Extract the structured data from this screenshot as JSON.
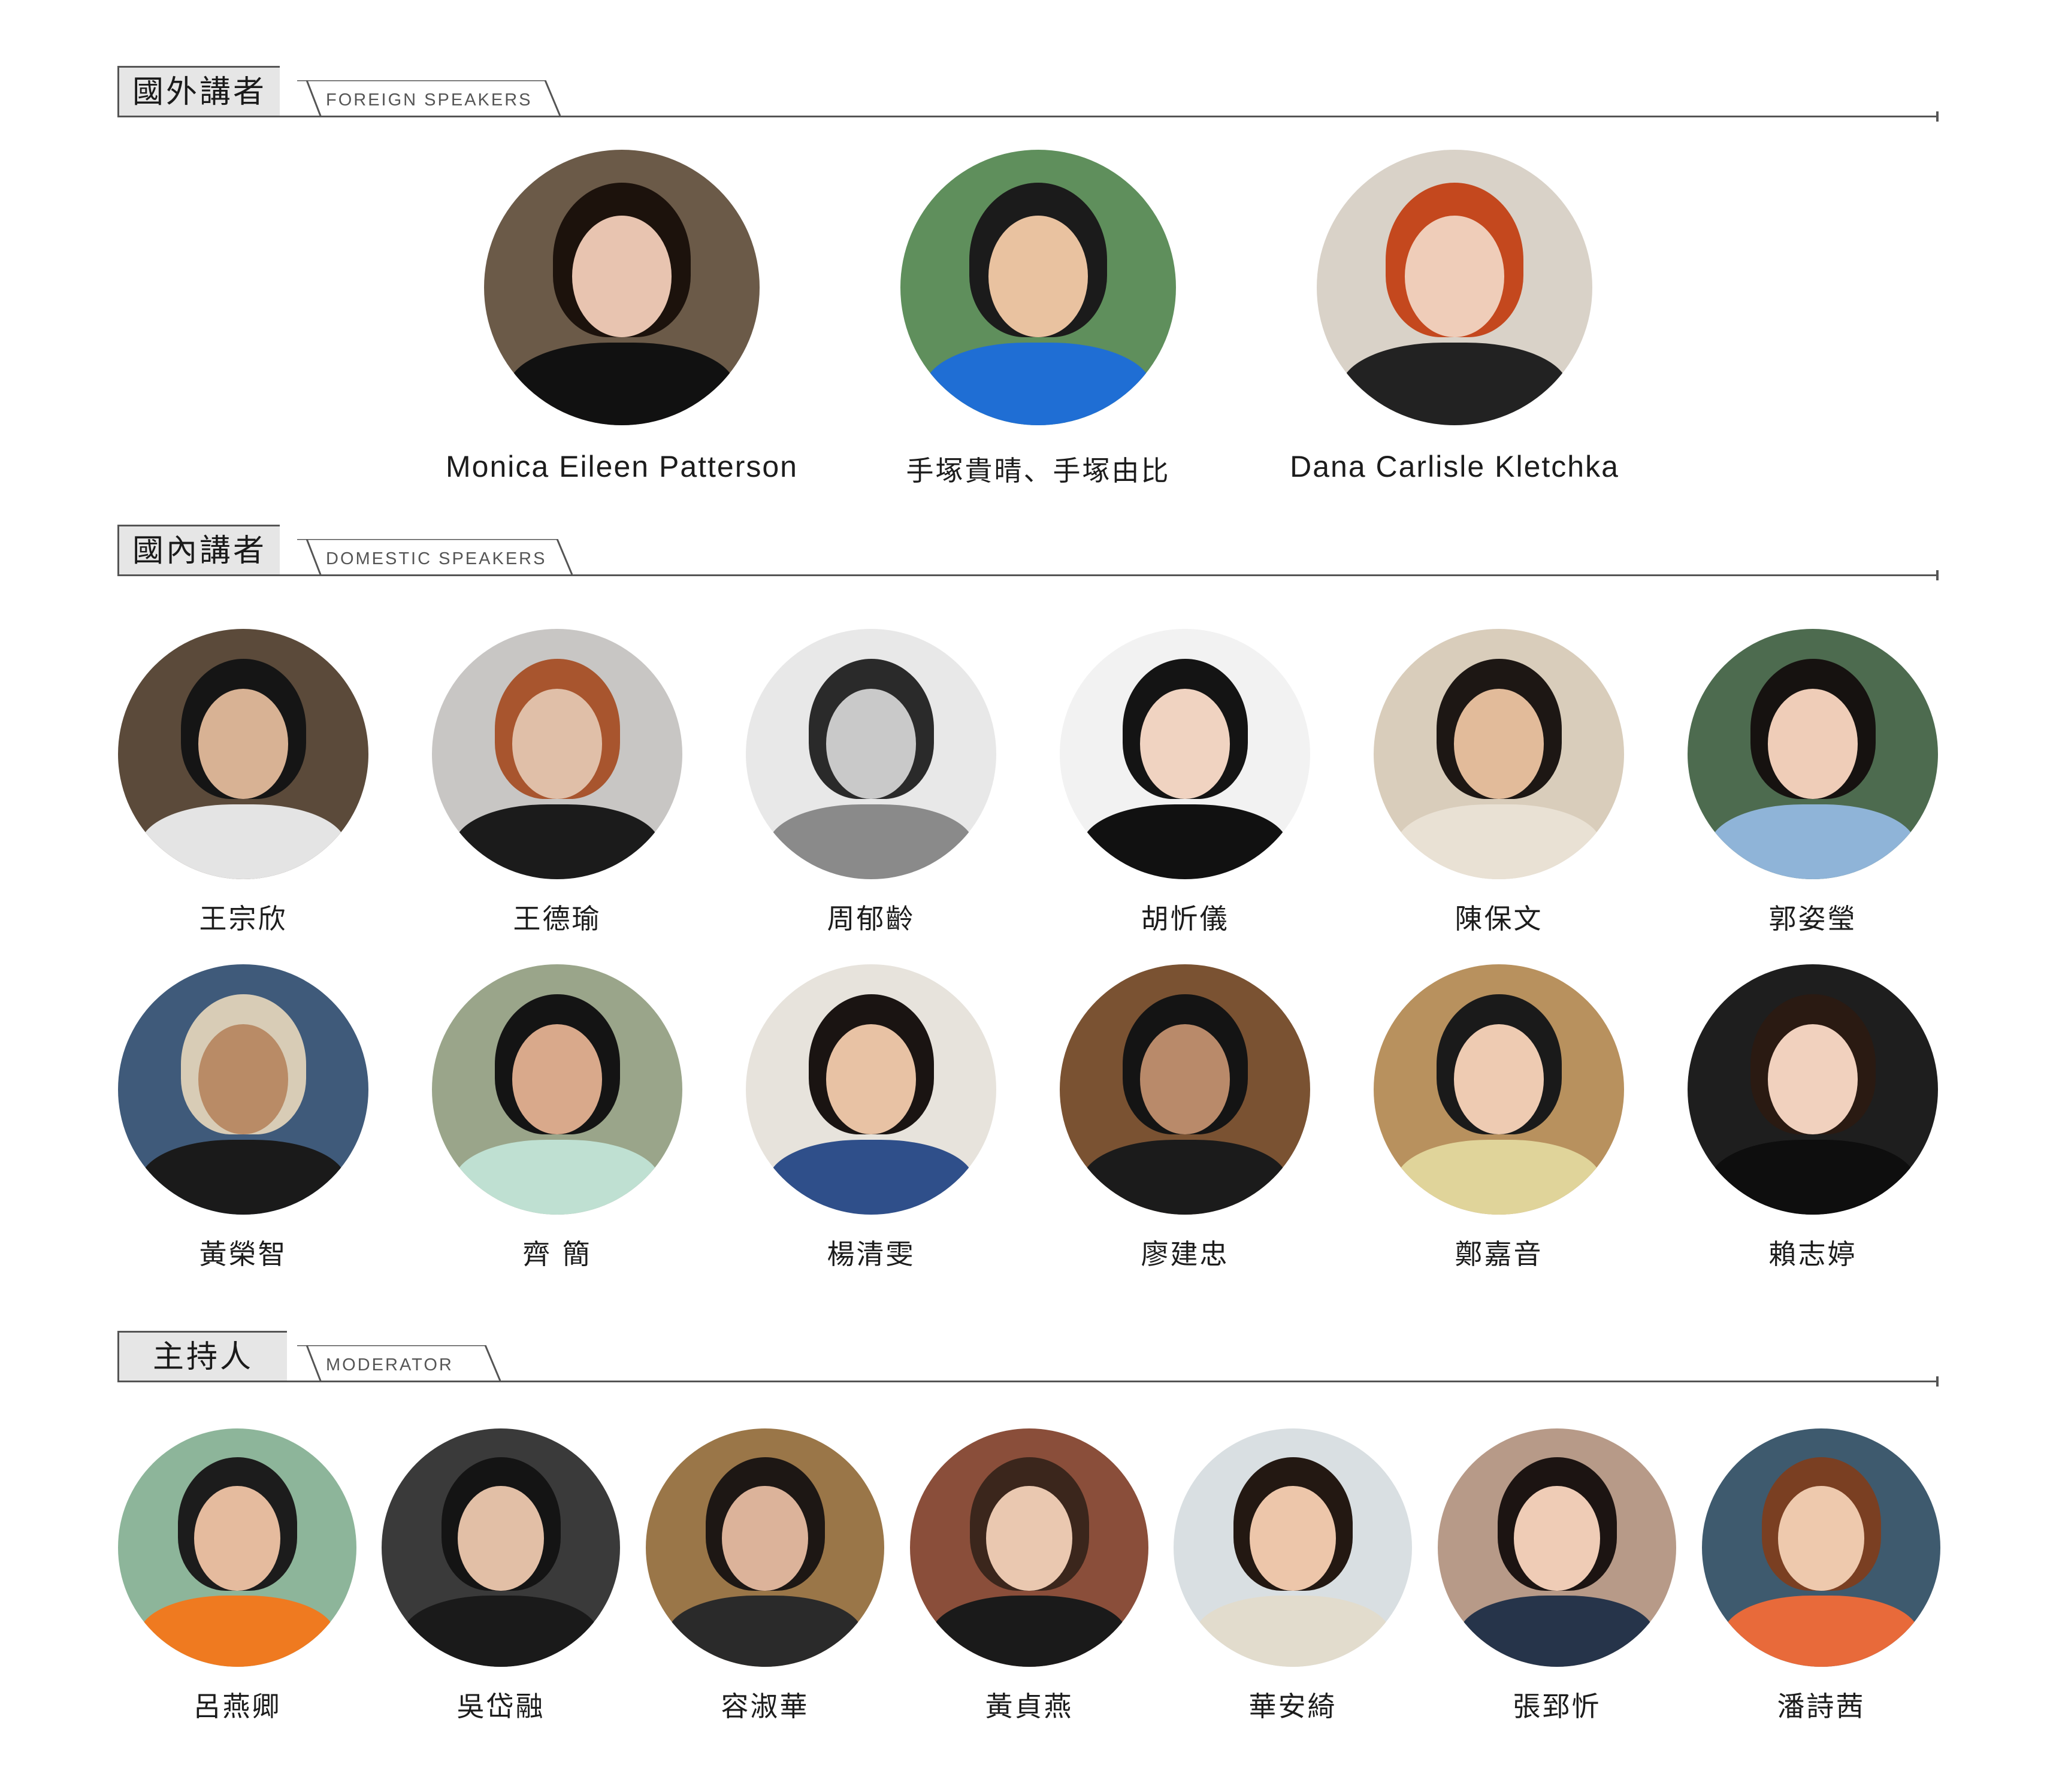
{
  "sections": {
    "foreign": {
      "title_cn": "國外講者",
      "title_en": "FOREIGN SPEAKERS",
      "speakers": [
        {
          "name": "Monica Eileen Patterson",
          "bg": "#6b5a48",
          "skin": "#e8c4b0",
          "hair": "#1c120c",
          "shirt": "#111111"
        },
        {
          "name": "手塚貴晴、手塚由比",
          "bg": "#5f8f5c",
          "skin": "#e9c2a0",
          "hair": "#1b1b1b",
          "shirt": "#1f6ed4"
        },
        {
          "name": "Dana Carlisle Kletchka",
          "bg": "#d9d2c8",
          "skin": "#efcdb9",
          "hair": "#c4481e",
          "shirt": "#222222"
        }
      ]
    },
    "domestic": {
      "title_cn": "國內講者",
      "title_en": "DOMESTIC SPEAKERS",
      "speakers": [
        {
          "name": "王宗欣",
          "bg": "#5b4a3a",
          "skin": "#d8b294",
          "hair": "#151515",
          "shirt": "#e4e4e4"
        },
        {
          "name": "王德瑜",
          "bg": "#c8c6c4",
          "skin": "#e0bfa8",
          "hair": "#a8552e",
          "shirt": "#1b1b1b"
        },
        {
          "name": "周郁齡",
          "bg": "#e8e8e8",
          "skin": "#c9c9c9",
          "hair": "#2a2a2a",
          "shirt": "#8a8a8a"
        },
        {
          "name": "胡忻儀",
          "bg": "#f2f2f2",
          "skin": "#f0d3c1",
          "hair": "#141414",
          "shirt": "#111111"
        },
        {
          "name": "陳保文",
          "bg": "#d9cdbb",
          "skin": "#e2bb9a",
          "hair": "#1d1714",
          "shirt": "#e9e1d4"
        },
        {
          "name": "郭姿瑩",
          "bg": "#4d6b4f",
          "skin": "#efcdb8",
          "hair": "#161210",
          "shirt": "#8fb4d8"
        },
        {
          "name": "黃榮智",
          "bg": "#3f5a7a",
          "skin": "#b98b66",
          "hair": "#d8ccb6",
          "shirt": "#1a1a1a"
        },
        {
          "name": "齊 簡",
          "bg": "#9aa58a",
          "skin": "#d9a98b",
          "hair": "#141414",
          "shirt": "#bfe0d2"
        },
        {
          "name": "楊清雯",
          "bg": "#e7e3dc",
          "skin": "#e8c2a4",
          "hair": "#1a1412",
          "shirt": "#2f4f8a"
        },
        {
          "name": "廖建忠",
          "bg": "#7a5232",
          "skin": "#b98a6a",
          "hair": "#141414",
          "shirt": "#1b1b1b"
        },
        {
          "name": "鄭嘉音",
          "bg": "#b8915e",
          "skin": "#eecbb2",
          "hair": "#1a1a1a",
          "shirt": "#e0d49a"
        },
        {
          "name": "賴志婷",
          "bg": "#1e1e1e",
          "skin": "#f1d1be",
          "hair": "#2a1a12",
          "shirt": "#0e0e0e"
        }
      ]
    },
    "moderator": {
      "title_cn": "主持人",
      "title_en": "MODERATOR",
      "speakers": [
        {
          "name": "呂燕卿",
          "bg": "#8db59a",
          "skin": "#e5bb9e",
          "hair": "#1c1c1c",
          "shirt": "#ef7a20"
        },
        {
          "name": "吳岱融",
          "bg": "#3a3a3a",
          "skin": "#e2bfa6",
          "hair": "#141414",
          "shirt": "#1a1a1a"
        },
        {
          "name": "容淑華",
          "bg": "#9a7648",
          "skin": "#dcb39a",
          "hair": "#1d1714",
          "shirt": "#2a2a2a"
        },
        {
          "name": "黃貞燕",
          "bg": "#8a4e3a",
          "skin": "#eac8b0",
          "hair": "#3b261c",
          "shirt": "#1a1a1a"
        },
        {
          "name": "華安綺",
          "bg": "#d9dfe2",
          "skin": "#edc6aa",
          "hair": "#231812",
          "shirt": "#e2dccd"
        },
        {
          "name": "張郅忻",
          "bg": "#b79a88",
          "skin": "#efccb6",
          "hair": "#1c1412",
          "shirt": "#26344a"
        },
        {
          "name": "潘詩茜",
          "bg": "#3e5a6e",
          "skin": "#eec9ad",
          "hair": "#7a3f22",
          "shirt": "#e86a3a"
        }
      ]
    }
  }
}
